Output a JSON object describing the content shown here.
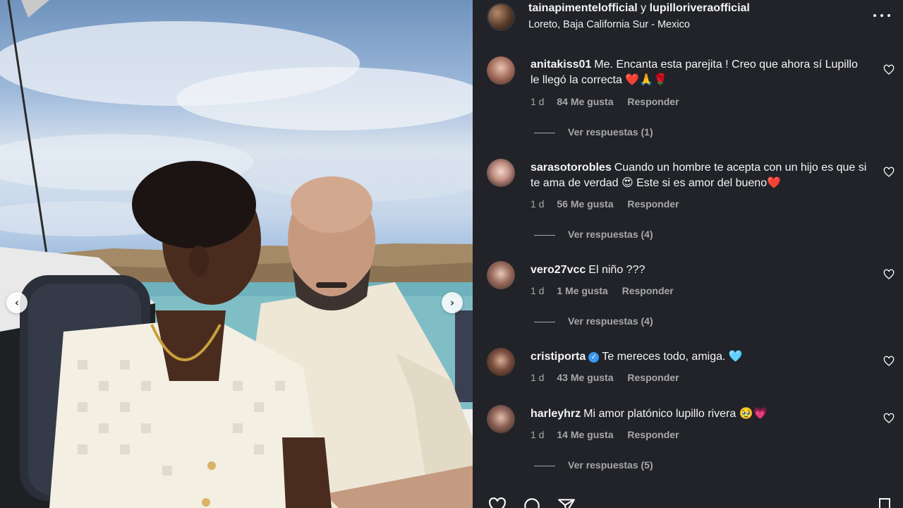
{
  "post": {
    "author_primary": "tainapimentelofficial",
    "conjunction": "y",
    "author_secondary": "lupilloriveraofficial",
    "location": "Loreto, Baja California Sur - Mexico"
  },
  "carousel": {
    "prev_icon": "‹",
    "next_icon": "›"
  },
  "comments": [
    {
      "username": "anitakiss01",
      "verified": false,
      "text": "Me. Encanta esta parejita ! Creo que ahora sí Lupillo le llegó la correcta ❤️🙏🌹",
      "time": "1 d",
      "likes": "84 Me gusta",
      "reply_label": "Responder",
      "view_replies": "Ver respuestas (1)"
    },
    {
      "username": "sarasotorobles",
      "verified": false,
      "text": "Cuando un hombre te acepta con un hijo es que si te ama de verdad 😍 Este si es amor del bueno❤️",
      "time": "1 d",
      "likes": "56 Me gusta",
      "reply_label": "Responder",
      "view_replies": "Ver respuestas (4)"
    },
    {
      "username": "vero27vcc",
      "verified": false,
      "text": "El niño ???",
      "time": "1 d",
      "likes": "1 Me gusta",
      "reply_label": "Responder",
      "view_replies": "Ver respuestas (4)"
    },
    {
      "username": "cristiporta",
      "verified": true,
      "text": "Te mereces todo, amiga. 🩵",
      "time": "1 d",
      "likes": "43 Me gusta",
      "reply_label": "Responder",
      "view_replies": ""
    },
    {
      "username": "harleyhrz",
      "verified": false,
      "text": "Mi amor platónico lupillo rivera 🥹💗",
      "time": "1 d",
      "likes": "14 Me gusta",
      "reply_label": "Responder",
      "view_replies": "Ver respuestas (5)"
    }
  ],
  "colors": {
    "panel_bg": "#212328",
    "text_primary": "#f5f5f5",
    "text_secondary": "#a8a8a8",
    "verified": "#3897f0"
  },
  "icons": [
    "more-options-icon",
    "heart-outline-icon",
    "comment-icon",
    "share-icon",
    "bookmark-icon",
    "chevron-left-icon",
    "chevron-right-icon",
    "verified-badge-icon"
  ]
}
